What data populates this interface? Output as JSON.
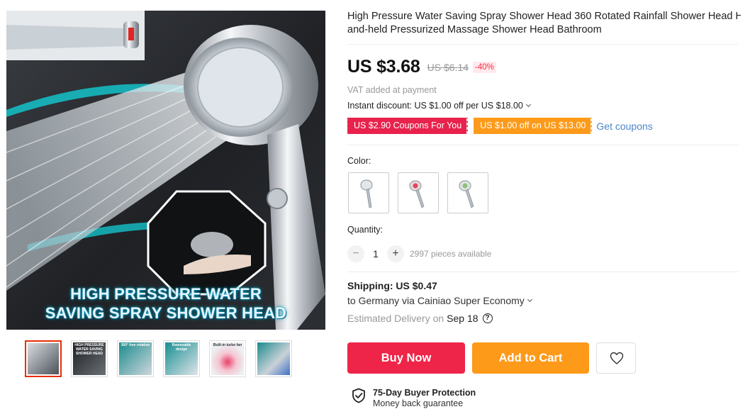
{
  "product": {
    "title_line1": "High Pressure Water Saving Spray Shower Head 360 Rotated Rainfall Shower Head H",
    "title_line2": "and-held Pressurized Massage Shower Head Bathroom"
  },
  "gallery": {
    "hero_caption_line1": "HIGH PRESSURE WATER",
    "hero_caption_line2": "SAVING SPRAY SHOWER HEAD",
    "thumbnails": [
      {
        "label": "",
        "icon": "shower-head-thumb-icon"
      },
      {
        "label": "HIGH PRESSURE WATER SAVING SHOWER HEAD",
        "icon": "shower-head-thumb-icon"
      },
      {
        "label": "360° free rotation",
        "icon": "shower-head-thumb-icon"
      },
      {
        "label": "Removable design",
        "icon": "shower-head-thumb-icon"
      },
      {
        "label": "Built-in turbo fan",
        "icon": "shower-head-thumb-icon"
      },
      {
        "label": "",
        "icon": "shower-head-thumb-icon"
      }
    ],
    "active_thumbnail": 0
  },
  "price": {
    "current": "US $3.68",
    "original": "US $6.14",
    "discount": "-40%"
  },
  "vat_note": "VAT added at payment",
  "instant_discount": "Instant discount: US $1.00 off per US $18.00",
  "coupons": {
    "coupon1": "US $2.90 Coupons For You",
    "coupon2": "US $1.00 off on US $13.00",
    "link": "Get coupons"
  },
  "color": {
    "label": "Color:",
    "options": [
      "silver-shower-head",
      "red-light-shower-head",
      "green-light-shower-head"
    ]
  },
  "quantity": {
    "label": "Quantity:",
    "value": "1",
    "minus": "−",
    "plus": "+",
    "available": "2997 pieces available"
  },
  "shipping": {
    "title": "Shipping: US $0.47",
    "to": "to Germany via Cainiao Super Economy",
    "estimated_label": "Estimated Delivery on",
    "estimated_date": "Sep 18",
    "help": "?"
  },
  "actions": {
    "buy_now": "Buy Now",
    "add_to_cart": "Add to Cart",
    "wishlist_icon": "heart-icon"
  },
  "protection": {
    "title": "75-Day Buyer Protection",
    "subtitle": "Money back guarantee",
    "icon": "shield-check-icon"
  },
  "colors": {
    "buy_now": "#ee2548",
    "add_to_cart": "#fd9a1a",
    "coupon_red": "#e8224c",
    "coupon_orange": "#fd9a1a",
    "link": "#4b86c9",
    "discount": "#ff2a42"
  }
}
